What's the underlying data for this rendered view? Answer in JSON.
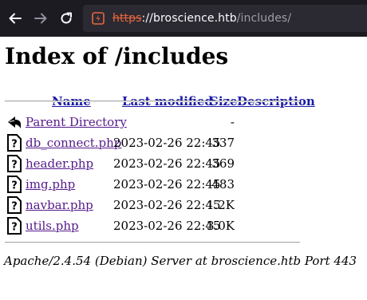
{
  "browser": {
    "url_scheme": "https",
    "url_host": "://broscience.htb",
    "url_path": "/includes/",
    "accent_color": "#e8673c"
  },
  "page": {
    "title": "Index of /includes",
    "columns": {
      "name": "Name",
      "last_modified": "Last modified",
      "size": "Size",
      "description": "Description"
    },
    "parent": {
      "label": "Parent Directory",
      "size": "-"
    },
    "files": [
      {
        "name": "db_connect.php",
        "modified": "2023-02-26 22:45",
        "size": "337"
      },
      {
        "name": "header.php",
        "modified": "2023-02-26 22:45",
        "size": "369"
      },
      {
        "name": "img.php",
        "modified": "2023-02-26 22:45",
        "size": "483"
      },
      {
        "name": "navbar.php",
        "modified": "2023-02-26 22:45",
        "size": "1.2K"
      },
      {
        "name": "utils.php",
        "modified": "2023-02-26 22:45",
        "size": "3.0K"
      }
    ],
    "footer": "Apache/2.4.54 (Debian) Server at broscience.htb Port 443"
  }
}
